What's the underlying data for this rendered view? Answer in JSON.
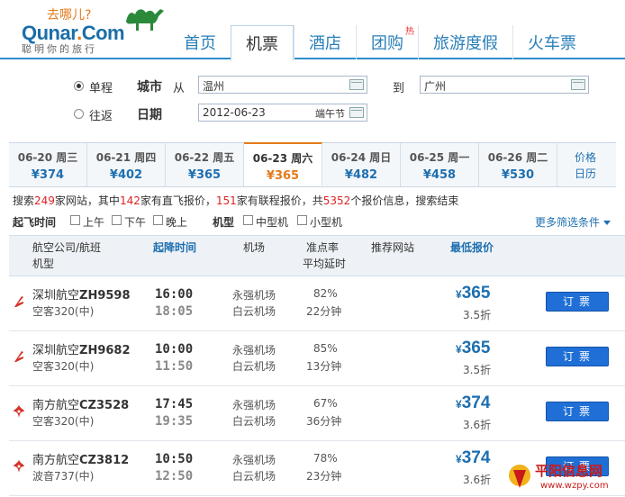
{
  "logo": {
    "cn": "去哪儿?",
    "brand_a": "Qunar",
    "brand_b": ".",
    "brand_c": "Com",
    "tagline": "聪明你的旅行"
  },
  "nav": [
    "首页",
    "机票",
    "酒店",
    "团购",
    "旅游度假",
    "火车票"
  ],
  "nav_hot": "热",
  "search": {
    "oneway": "单程",
    "roundtrip": "往返",
    "city_label": "城市",
    "from_label": "从",
    "from_value": "温州",
    "to_label": "到",
    "to_value": "广州",
    "date_label": "日期",
    "date_value": "2012-06-23",
    "holiday": "端午节"
  },
  "dates": [
    {
      "d": "06-20 周三",
      "p": "¥374"
    },
    {
      "d": "06-21 周四",
      "p": "¥402"
    },
    {
      "d": "06-22 周五",
      "p": "¥365"
    },
    {
      "d": "06-23 周六",
      "p": "¥365"
    },
    {
      "d": "06-24 周日",
      "p": "¥482"
    },
    {
      "d": "06-25 周一",
      "p": "¥458"
    },
    {
      "d": "06-26 周二",
      "p": "¥530"
    }
  ],
  "calendar_line1": "价格",
  "calendar_line2": "日历",
  "summary": {
    "a": "搜索",
    "sites": "249",
    "b": "家网站，其中",
    "direct": "142",
    "c": "家有直飞报价，",
    "connect": "151",
    "d": "家有联程报价，共",
    "total": "5352",
    "e": "个报价信息，搜索结束"
  },
  "filters": {
    "time_label": "起飞时间",
    "am": "上午",
    "pm": "下午",
    "night": "晚上",
    "type_label": "机型",
    "mid": "中型机",
    "small": "小型机",
    "more": "更多筛选条件"
  },
  "thead": {
    "airline": "航空公司/航班",
    "model": "机型",
    "time": "起降时间",
    "airport": "机场",
    "ontime": "准点率",
    "avg_delay": "平均延时",
    "site": "推荐网站",
    "price": "最低报价"
  },
  "flights": [
    {
      "airline": "深圳航空",
      "code": "ZH9598",
      "model": "空客320(中)",
      "dep": "16:00",
      "arr": "18:05",
      "ap1": "永强机场",
      "ap2": "白云机场",
      "rate": "82%",
      "delay": "22分钟",
      "price": "365",
      "disc": "3.5折",
      "book": "订票"
    },
    {
      "airline": "深圳航空",
      "code": "ZH9682",
      "model": "空客320(中)",
      "dep": "10:00",
      "arr": "11:50",
      "ap1": "永强机场",
      "ap2": "白云机场",
      "rate": "85%",
      "delay": "13分钟",
      "price": "365",
      "disc": "3.5折",
      "book": "订票"
    },
    {
      "airline": "南方航空",
      "code": "CZ3528",
      "model": "空客320(中)",
      "dep": "17:45",
      "arr": "19:35",
      "ap1": "永强机场",
      "ap2": "白云机场",
      "rate": "67%",
      "delay": "36分钟",
      "price": "374",
      "disc": "3.6折",
      "book": "订票"
    },
    {
      "airline": "南方航空",
      "code": "CZ3812",
      "model": "波音737(中)",
      "dep": "10:50",
      "arr": "12:50",
      "ap1": "永强机场",
      "ap2": "白云机场",
      "rate": "78%",
      "delay": "23分钟",
      "price": "374",
      "disc": "3.6折",
      "book": "订票"
    }
  ],
  "currency": "¥",
  "watermark": {
    "line1": "平阳信息网",
    "line2": "www.wzpy.com"
  }
}
